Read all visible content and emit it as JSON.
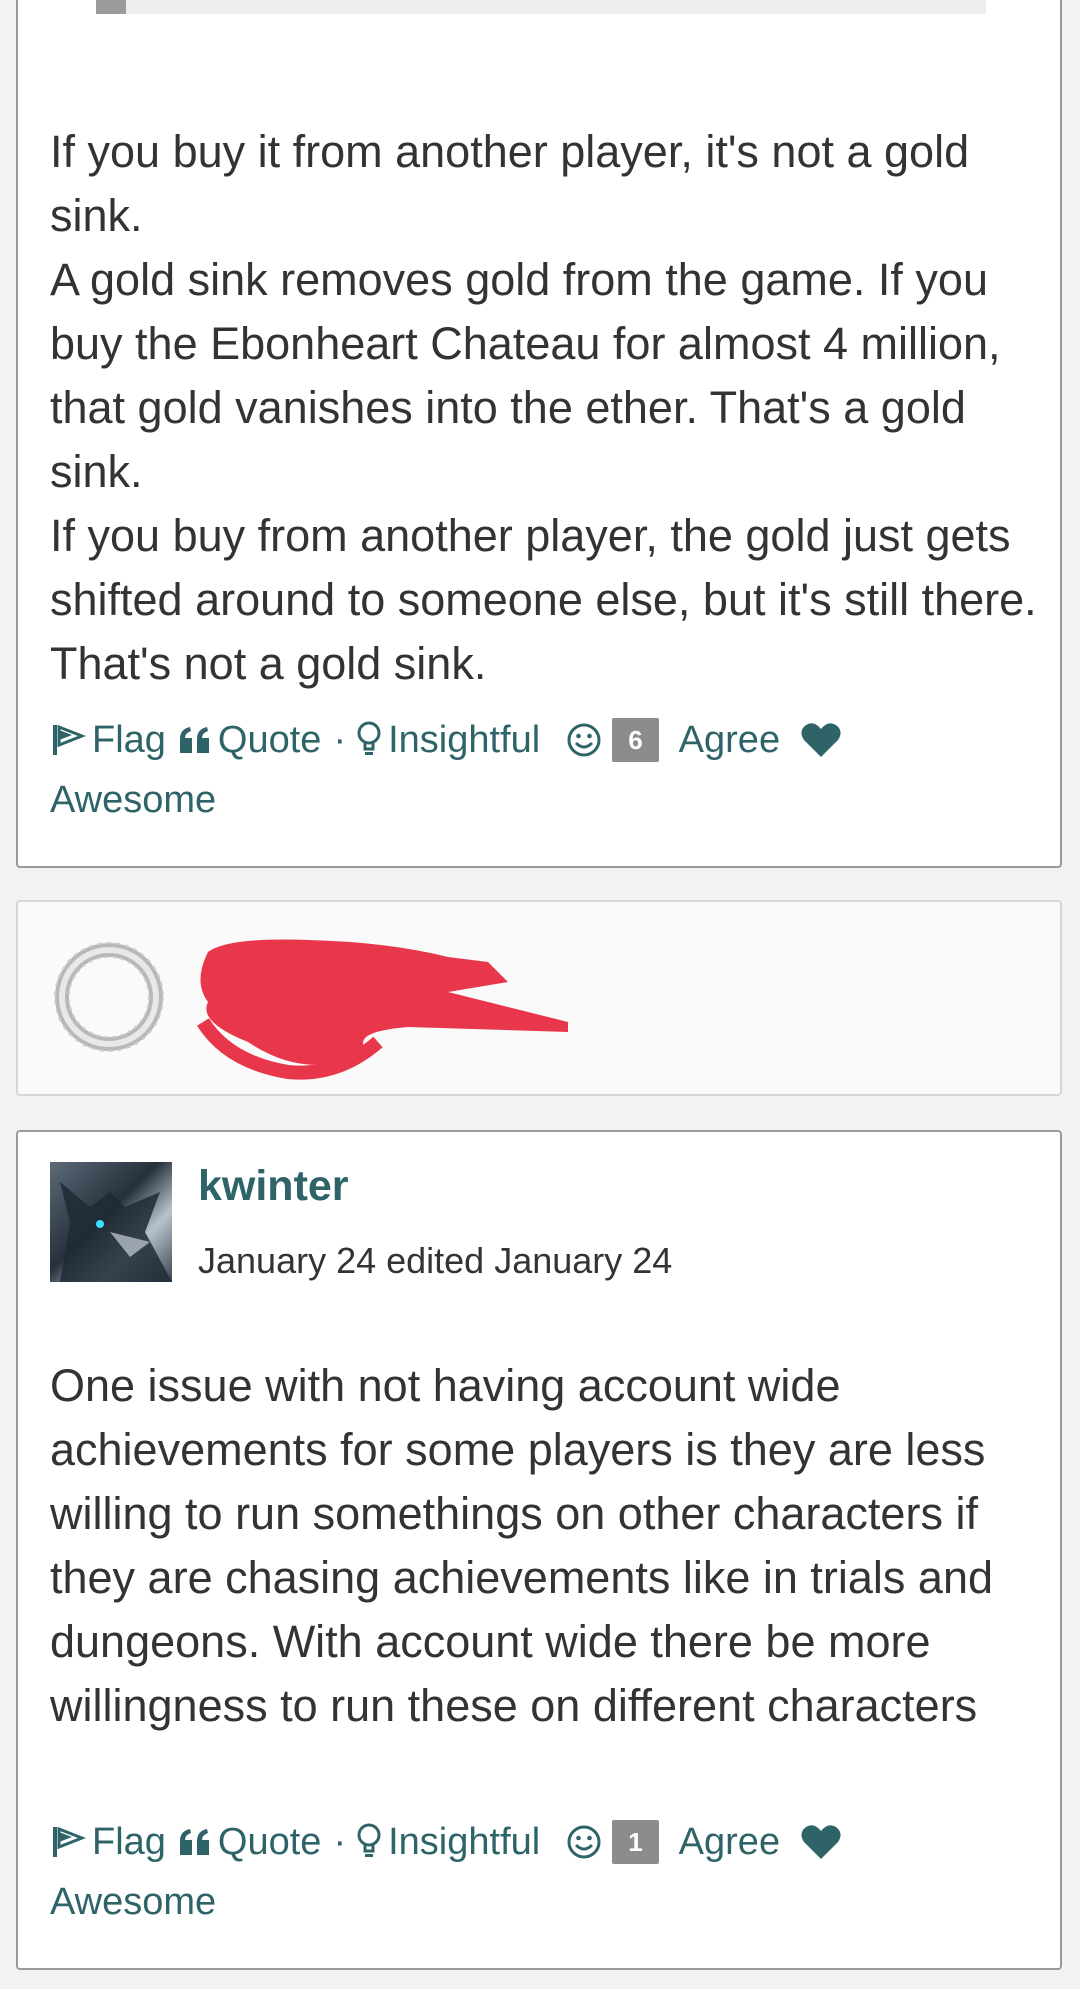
{
  "colors": {
    "link": "#2e6468",
    "text": "#333333",
    "badge": "#8c8c8c",
    "redaction": "#e8374a"
  },
  "post1": {
    "paragraphs": [
      "If you buy it from another player, it's not a gold sink.",
      "A gold sink removes gold from the game. If you buy the Ebonheart Chateau for almost 4 million, that gold vanishes into the ether. That's a gold sink.",
      "If you buy from another player, the gold just gets shifted around to someone else, but it's still there. That's not a gold sink."
    ],
    "reactions": {
      "flag": "Flag",
      "quote": "Quote",
      "separator": "·",
      "insightful": "Insightful",
      "agree_count": "6",
      "agree": "Agree",
      "awesome": "Awesome"
    }
  },
  "post2": {
    "avatar_icon": "eso-ouroboros-icon",
    "name_redacted": true
  },
  "post3": {
    "author": "kwinter",
    "date": "January 24 edited January 24",
    "paragraphs": [
      "One issue with not having account wide achievements for some players is they are less willing to run somethings on other characters if they are chasing achievements like in trials and dungeons. With account wide there be more willingness to run these on different characters"
    ],
    "reactions": {
      "flag": "Flag",
      "quote": "Quote",
      "separator": "·",
      "insightful": "Insightful",
      "agree_count": "1",
      "agree": "Agree",
      "awesome": "Awesome"
    }
  }
}
